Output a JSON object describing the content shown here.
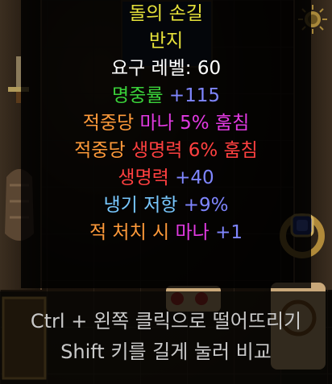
{
  "tooltip": {
    "item_name": "돌의 손길",
    "item_type": "반지",
    "level_req": "요구 레벨: 60",
    "stats": [
      {
        "segments": [
          {
            "text": "명중률 ",
            "color": "green"
          },
          {
            "text": "+115",
            "color": "blue"
          }
        ]
      },
      {
        "segments": [
          {
            "text": "적중당 ",
            "color": "orange"
          },
          {
            "text": "마나 5% 훔침",
            "color": "magenta"
          }
        ]
      },
      {
        "segments": [
          {
            "text": "적중당 ",
            "color": "orange"
          },
          {
            "text": "생명력 6% 훔침",
            "color": "red"
          }
        ]
      },
      {
        "segments": [
          {
            "text": "생명력 ",
            "color": "red"
          },
          {
            "text": "+40",
            "color": "blue"
          }
        ]
      },
      {
        "segments": [
          {
            "text": "냉기 저항 ",
            "color": "cyan"
          },
          {
            "text": "+9%",
            "color": "blue"
          }
        ]
      },
      {
        "segments": [
          {
            "text": "적 처치 시 ",
            "color": "orange"
          },
          {
            "text": "마나 ",
            "color": "magenta"
          },
          {
            "text": "+1",
            "color": "blue"
          }
        ]
      }
    ]
  },
  "footer": {
    "hint_drop": "Ctrl + 왼쪽 클릭으로 떨어뜨리기",
    "hint_compare": "Shift 키를 길게 눌러 비교"
  },
  "colors": {
    "name": "#e6e13a",
    "green": "#3ad23a",
    "blue": "#7f86ff",
    "orange": "#ff9a3a",
    "magenta": "#e23ae2",
    "red": "#ff4040",
    "cyan": "#78c8ff"
  }
}
